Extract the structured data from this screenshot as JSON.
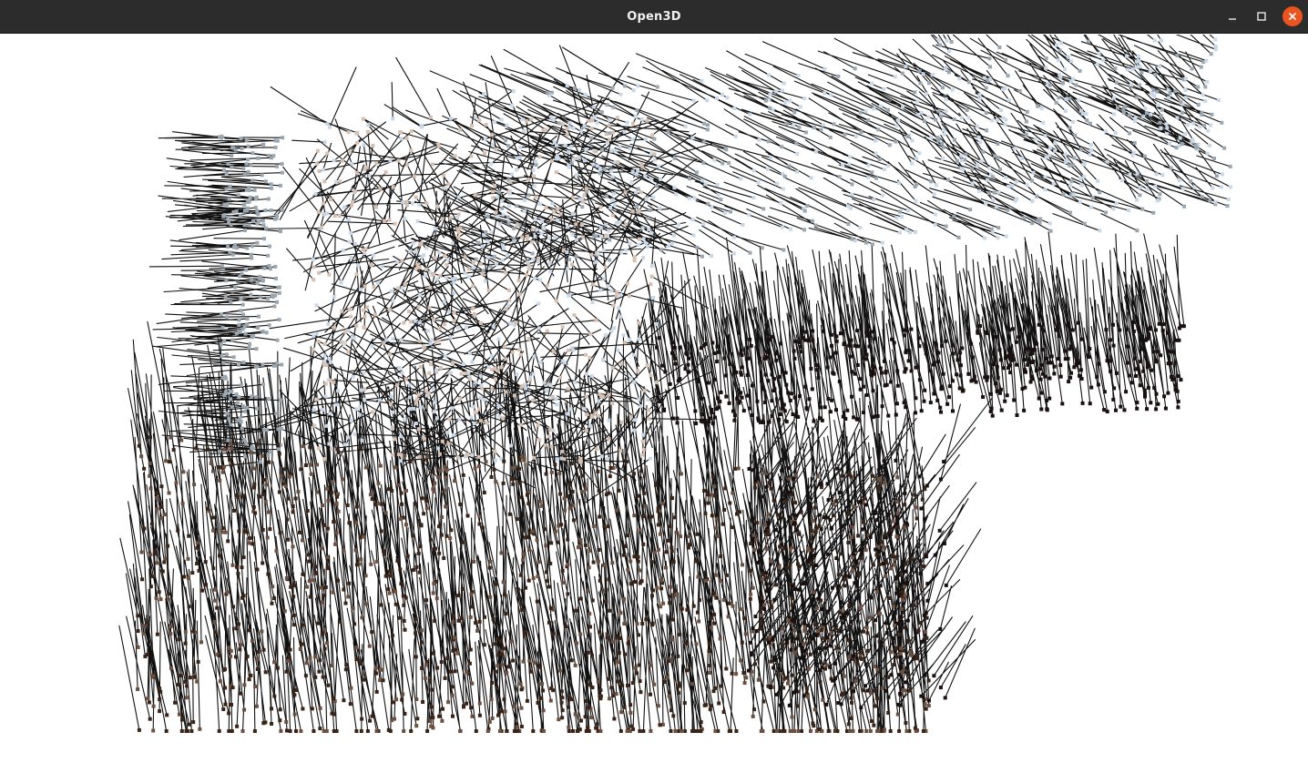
{
  "window": {
    "title": "Open3D",
    "controls": {
      "minimize_icon": "minimize-icon",
      "maximize_icon": "maximize-icon",
      "close_icon": "close-icon",
      "close_color": "#e95420"
    }
  },
  "scene": {
    "type": "point-cloud-with-normals",
    "background_color": "#ffffff",
    "normal_line_color": "#111111",
    "point_colors": [
      "#c8d8e8",
      "#9aa6b0",
      "#6e5040",
      "#3a2418",
      "#1a1010",
      "#d8c0b0"
    ]
  }
}
